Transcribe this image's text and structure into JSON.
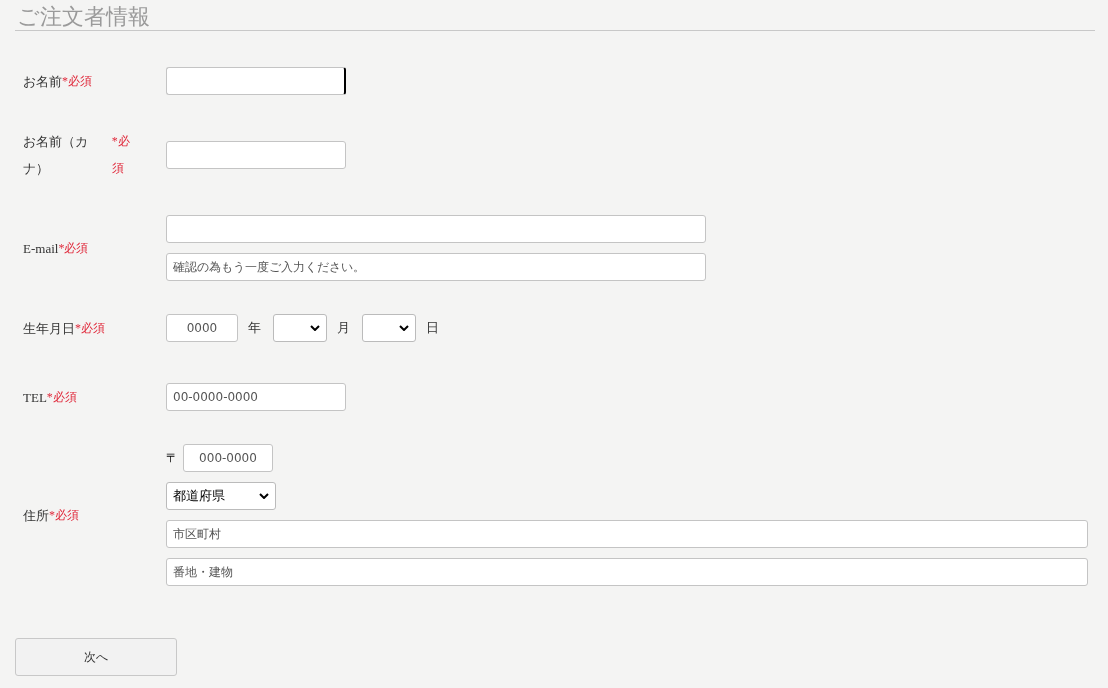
{
  "title": "ご注文者情報",
  "rows": [
    {
      "label": "お名前",
      "required": "*必須",
      "fields": [
        {
          "kind": "short",
          "focused": true
        }
      ]
    },
    {
      "label": "お名前（カナ）",
      "required": "*必須",
      "fields": [
        {
          "kind": "short",
          "focused": false
        }
      ]
    },
    {
      "label": "E-mail",
      "required": "*必須",
      "fields": [
        {
          "kind": "medium",
          "focused": false
        },
        {
          "kind": "medium",
          "placeholder": "確認の為もう一度ご入力ください。",
          "focused": false
        }
      ]
    },
    {
      "label": "生年月日",
      "required": "*必須",
      "fields": [
        {
          "kind": "year",
          "placeholder": "0000"
        },
        {
          "kind": "unit",
          "text": "年"
        },
        {
          "kind": "dropdown"
        },
        {
          "kind": "unit",
          "text": "月"
        },
        {
          "kind": "dropdown"
        },
        {
          "kind": "unit",
          "text": "日"
        }
      ]
    },
    {
      "label": "TEL",
      "required": "*必須",
      "fields": [
        {
          "kind": "short",
          "placeholder": "00-0000-0000",
          "focused": false
        }
      ]
    },
    {
      "label": "住所",
      "required": "*必須",
      "fields": [
        {
          "kind": "postal",
          "mark": "〒",
          "placeholder": "000-0000"
        },
        {
          "kind": "prefecture",
          "value": "都道府県"
        },
        {
          "kind": "wide",
          "placeholder": "市区町村",
          "focused": false
        },
        {
          "kind": "wide",
          "placeholder": "番地・建物",
          "focused": false
        }
      ]
    }
  ],
  "button": "次へ"
}
